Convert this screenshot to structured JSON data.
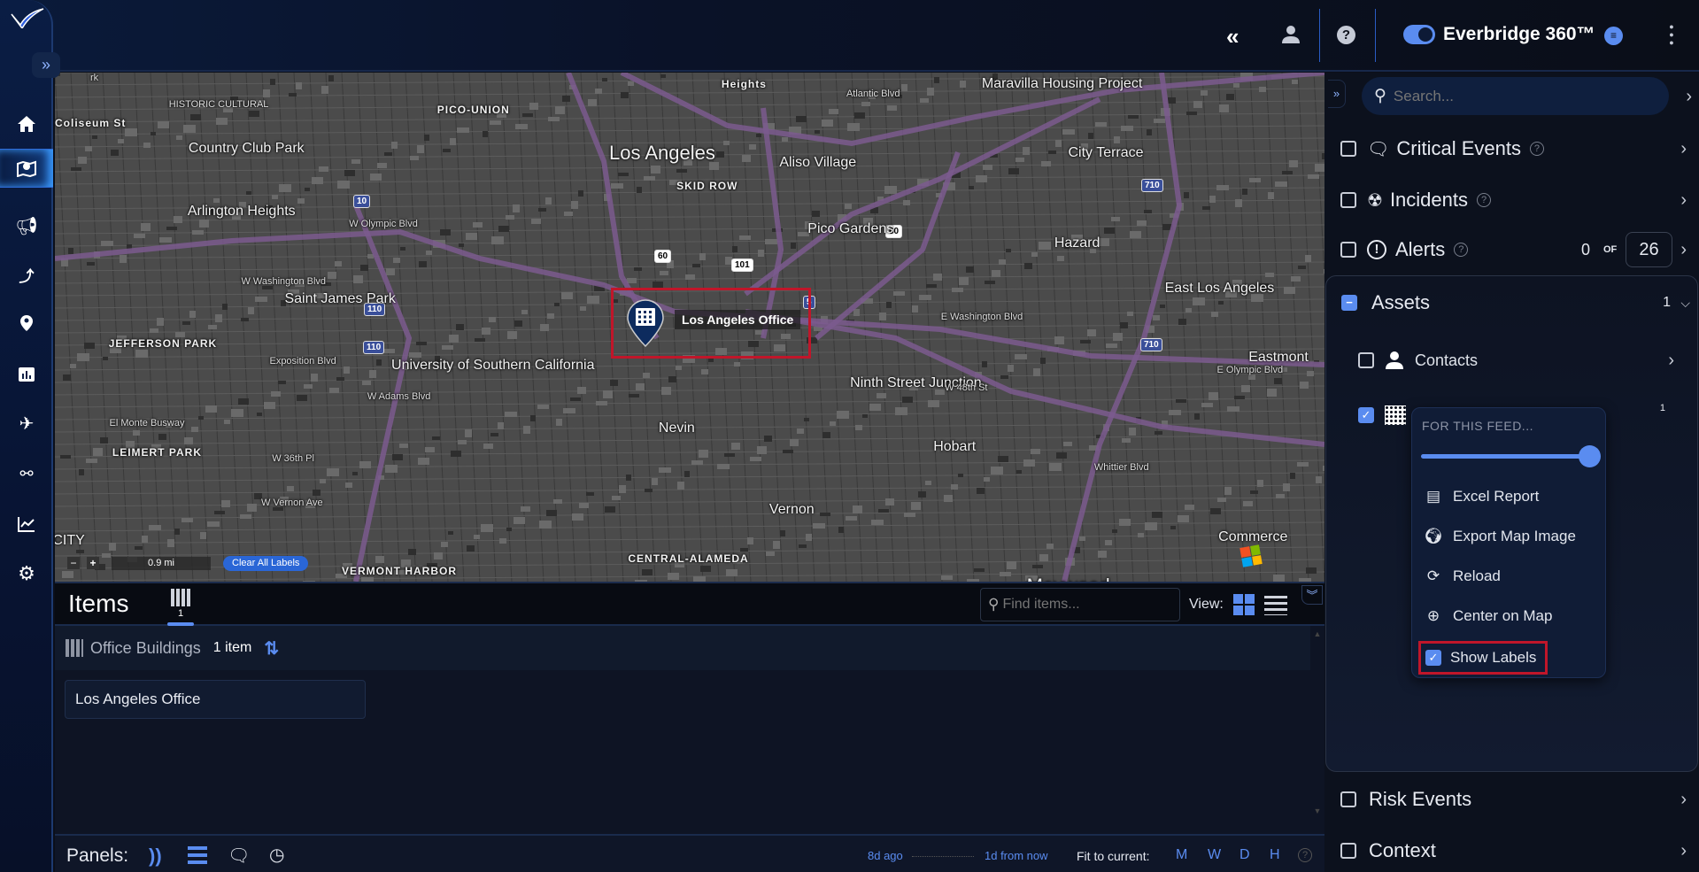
{
  "header": {
    "brand": "Everbridge 360™",
    "toggle_on": true,
    "icons": [
      "collapse-double-left-icon",
      "user-icon",
      "help-icon",
      "chat-icon",
      "kebab-menu-icon"
    ]
  },
  "sidebar": {
    "items": [
      {
        "name": "home",
        "icon": "home-icon"
      },
      {
        "name": "map",
        "icon": "map-pin-icon",
        "active": true
      },
      {
        "name": "communications",
        "icon": "megaphone-icon"
      },
      {
        "name": "travel-route",
        "icon": "route-icon"
      },
      {
        "name": "location",
        "icon": "location-person-icon"
      },
      {
        "name": "reports",
        "icon": "bar-chart-icon"
      },
      {
        "name": "travel",
        "icon": "airplane-icon"
      },
      {
        "name": "integrations",
        "icon": "network-icon"
      },
      {
        "name": "analytics",
        "icon": "line-chart-icon"
      },
      {
        "name": "settings",
        "icon": "gear-icon"
      }
    ]
  },
  "map": {
    "marker_label": "Los Angeles Office",
    "scale": "0.9 mi",
    "zoom_out": "−",
    "zoom_in": "+",
    "clear_labels": "Clear All Labels",
    "highway_shields": [
      "10",
      "110",
      "110",
      "60",
      "101",
      "5",
      "710",
      "710",
      "60"
    ],
    "labels": [
      "Los Angeles",
      "Country Club Park",
      "Arlington Heights",
      "Saint James Park",
      "JEFFERSON PARK",
      "University of Southern California",
      "LEIMERT PARK",
      "VERMONT HARBOR",
      "PICO-UNION",
      "Aliso Village",
      "Pico Gardens",
      "SKID ROW",
      "Ninth Street Junction",
      "Nevin",
      "Hobart",
      "Vernon",
      "CENTRAL-ALAMEDA",
      "Maywood",
      "Commerce",
      "Eastmont",
      "East Los Angeles",
      "Hazard",
      "City Terrace",
      "Maravilla Housing Project",
      "Heights",
      "HISTORIC CULTURAL",
      "W Olympic Blvd",
      "W Washington Blvd",
      "W Adams Blvd",
      "Exposition Blvd",
      "W 36th Pl",
      "W Vernon Ave",
      "W 48th St",
      "E Olympic Blvd",
      "Whittier Blvd",
      "E Washington Blvd",
      "Atlantic Blvd",
      "El Monte Busway",
      "Coliseum St",
      "-CITY",
      "rk"
    ]
  },
  "items": {
    "title": "Items",
    "tab_count": "1",
    "find_placeholder": "Find items...",
    "view_label": "View:",
    "group": {
      "name": "Office Buildings",
      "count": "1 item"
    },
    "cards": [
      "Los Angeles Office"
    ]
  },
  "footer": {
    "panels_label": "Panels:",
    "time_start": "8d ago",
    "time_end": "1d from now",
    "fit_label": "Fit to current:",
    "fit_options": [
      "M",
      "W",
      "D",
      "H"
    ]
  },
  "right_panel": {
    "search_placeholder": "Search...",
    "critical_events": "Critical Events",
    "incidents": "Incidents",
    "alerts": {
      "label": "Alerts",
      "shown": "0",
      "of": "OF",
      "total": "26"
    },
    "assets": {
      "label": "Assets",
      "count": "1",
      "contacts": "Contacts",
      "office_count": "1"
    },
    "risk_events": "Risk Events",
    "context": "Context",
    "popup": {
      "heading": "FOR THIS FEED...",
      "opacity_percent": 100,
      "items": [
        "Excel Report",
        "Export Map Image",
        "Reload",
        "Center on Map",
        "Show Labels"
      ],
      "show_labels_checked": true
    }
  },
  "colors": {
    "accent": "#5a8cf0",
    "highlight_border": "#c0162a",
    "panel_bg": "#0c111d",
    "marker": "#0d2b5e"
  }
}
